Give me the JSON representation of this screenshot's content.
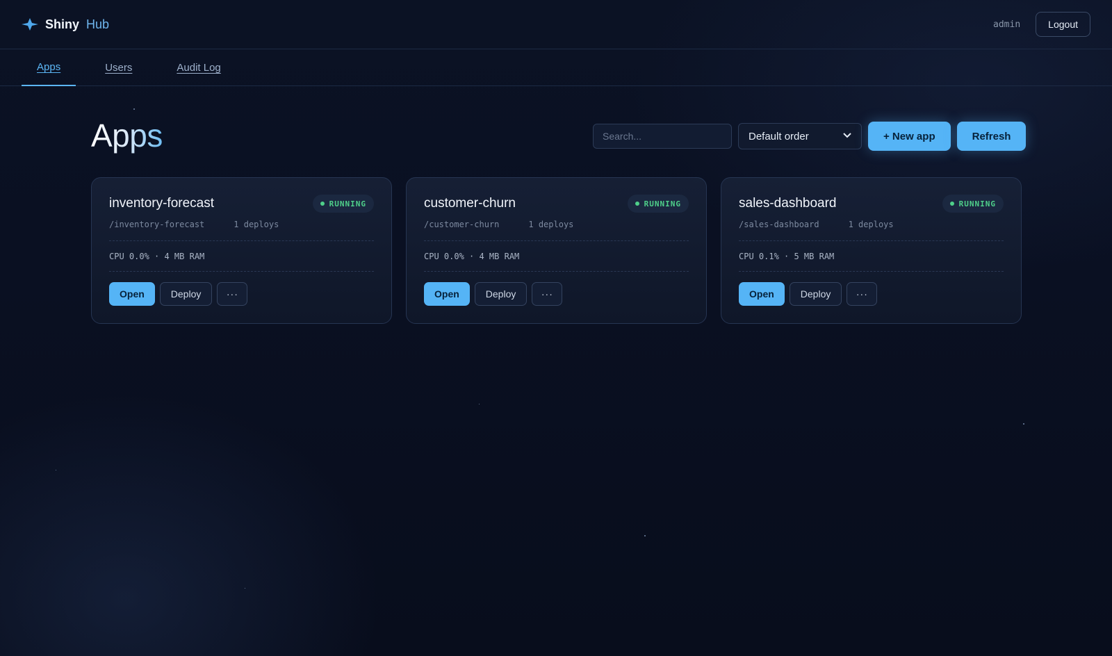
{
  "header": {
    "brand_name": "Shiny",
    "brand_sub": "Hub",
    "user": "admin",
    "logout_label": "Logout"
  },
  "tabs": [
    {
      "label": "Apps",
      "active": true
    },
    {
      "label": "Users",
      "active": false
    },
    {
      "label": "Audit Log",
      "active": false
    }
  ],
  "main": {
    "title": "Apps",
    "search_placeholder": "Search...",
    "sort_selected": "Default order",
    "new_app_label": "+ New app",
    "refresh_label": "Refresh"
  },
  "apps": [
    {
      "name": "inventory-forecast",
      "status": "RUNNING",
      "path": "/inventory-forecast",
      "deploys": "1 deploys",
      "stats": "CPU 0.0% · 4 MB RAM"
    },
    {
      "name": "customer-churn",
      "status": "RUNNING",
      "path": "/customer-churn",
      "deploys": "1 deploys",
      "stats": "CPU 0.0% · 4 MB RAM"
    },
    {
      "name": "sales-dashboard",
      "status": "RUNNING",
      "path": "/sales-dashboard",
      "deploys": "1 deploys",
      "stats": "CPU 0.1% · 5 MB RAM"
    }
  ],
  "card_actions": {
    "open_label": "Open",
    "deploy_label": "Deploy",
    "more_label": "···"
  },
  "colors": {
    "accent": "#55b4f6",
    "status_running": "#4fd08a",
    "background": "#0a1022"
  }
}
